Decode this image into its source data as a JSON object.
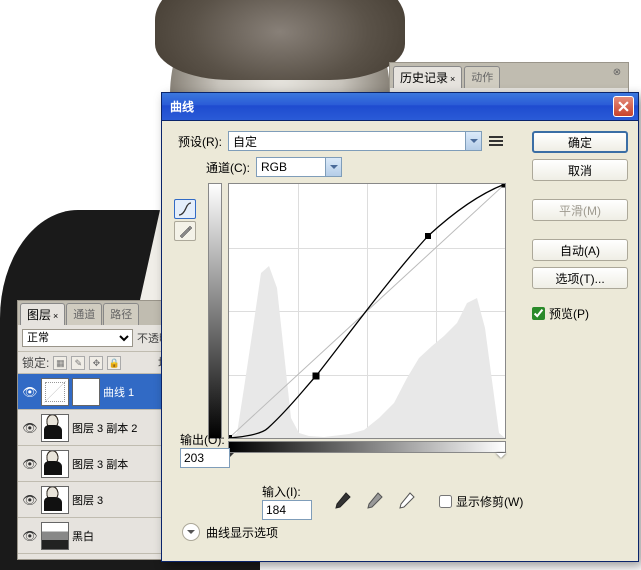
{
  "history_panel": {
    "tab_active": "历史记录",
    "tab_inactive": "动作"
  },
  "layers_panel": {
    "tabs": {
      "layers": "图层",
      "channels": "通道",
      "paths": "路径"
    },
    "blend_mode": "正常",
    "opacity_label": "不透明",
    "lock_label": "锁定:",
    "fill_label": "填",
    "layers": [
      {
        "name": "曲线 1",
        "selected": true,
        "type": "curves"
      },
      {
        "name": "图层 3 副本 2",
        "selected": false,
        "type": "photo"
      },
      {
        "name": "图层 3 副本",
        "selected": false,
        "type": "photo"
      },
      {
        "name": "图层 3",
        "selected": false,
        "type": "photo"
      },
      {
        "name": "黑白",
        "selected": false,
        "type": "bw"
      }
    ]
  },
  "dialog": {
    "title": "曲线",
    "preset_label": "预设(R):",
    "preset_value": "自定",
    "channel_label": "通道(C):",
    "channel_value": "RGB",
    "output_label": "输出(O):",
    "output_value": "203",
    "input_label": "输入(I):",
    "input_value": "184",
    "show_clipping": "显示修剪(W)",
    "disclosure_label": "曲线显示选项",
    "buttons": {
      "ok": "确定",
      "cancel": "取消",
      "smooth": "平滑(M)",
      "auto": "自动(A)",
      "options": "选项(T)...",
      "preview": "预览(P)"
    }
  },
  "chart_data": {
    "type": "line",
    "title": "曲线",
    "xlabel": "输入",
    "ylabel": "输出",
    "xlim": [
      0,
      255
    ],
    "ylim": [
      0,
      255
    ],
    "series": [
      {
        "name": "baseline",
        "x": [
          0,
          255
        ],
        "y": [
          0,
          255
        ]
      },
      {
        "name": "curve",
        "x": [
          0,
          36,
          80,
          184,
          255
        ],
        "y": [
          0,
          10,
          62,
          203,
          255
        ]
      }
    ],
    "selected_point": {
      "input": 184,
      "output": 203
    },
    "channel": "RGB",
    "histogram_peaks_x": [
      30,
      42,
      155,
      180,
      205,
      236
    ]
  }
}
